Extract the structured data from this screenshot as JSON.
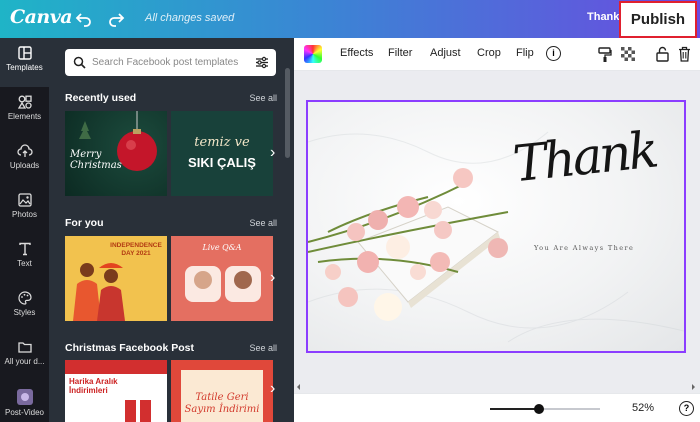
{
  "topbar": {
    "logo": "Canva",
    "undo_icon": "undo-icon",
    "redo_icon": "redo-icon",
    "save_status": "All changes saved",
    "design_title": "Thank You",
    "publish_label": "Publish"
  },
  "rail": {
    "items": [
      {
        "label": "Templates",
        "icon": "templates-icon"
      },
      {
        "label": "Elements",
        "icon": "elements-icon"
      },
      {
        "label": "Uploads",
        "icon": "cloud-upload-icon"
      },
      {
        "label": "Photos",
        "icon": "photo-icon"
      },
      {
        "label": "Text",
        "icon": "text-icon"
      },
      {
        "label": "Styles",
        "icon": "palette-icon"
      },
      {
        "label": "All your d...",
        "icon": "folder-icon"
      },
      {
        "label": "Post-Video",
        "icon": "video-icon"
      }
    ]
  },
  "panel": {
    "search_placeholder": "Search Facebook post templates",
    "sections": [
      {
        "title": "Recently used",
        "see_all": "See all",
        "thumbs": [
          {
            "text": "Merry Christmas"
          },
          {
            "text1": "temiz ve",
            "text2": "SIKI ÇALIŞ"
          }
        ]
      },
      {
        "title": "For you",
        "see_all": "See all",
        "thumbs": [
          {
            "text": "INDEPENDENCE DAY 2021"
          },
          {
            "text": "Live Q&A"
          }
        ]
      },
      {
        "title": "Christmas Facebook Post",
        "see_all": "See all",
        "thumbs": [
          {
            "text": "Harika Aralık İndirimleri"
          },
          {
            "text1": "Tatile Geri",
            "text2": "Sayım İndirimi"
          }
        ]
      }
    ]
  },
  "toolbar": {
    "effects": "Effects",
    "filter": "Filter",
    "adjust": "Adjust",
    "crop": "Crop",
    "flip": "Flip",
    "info": "i"
  },
  "design": {
    "headline": "Thank",
    "subline": "You Are Always There"
  },
  "bottom": {
    "zoom": "52%",
    "zoom_fraction": 0.52,
    "help": "?"
  },
  "colors": {
    "accent": "#8b3dff",
    "highlight": "#e0202f",
    "panel": "#293039",
    "rail": "#18191f"
  }
}
